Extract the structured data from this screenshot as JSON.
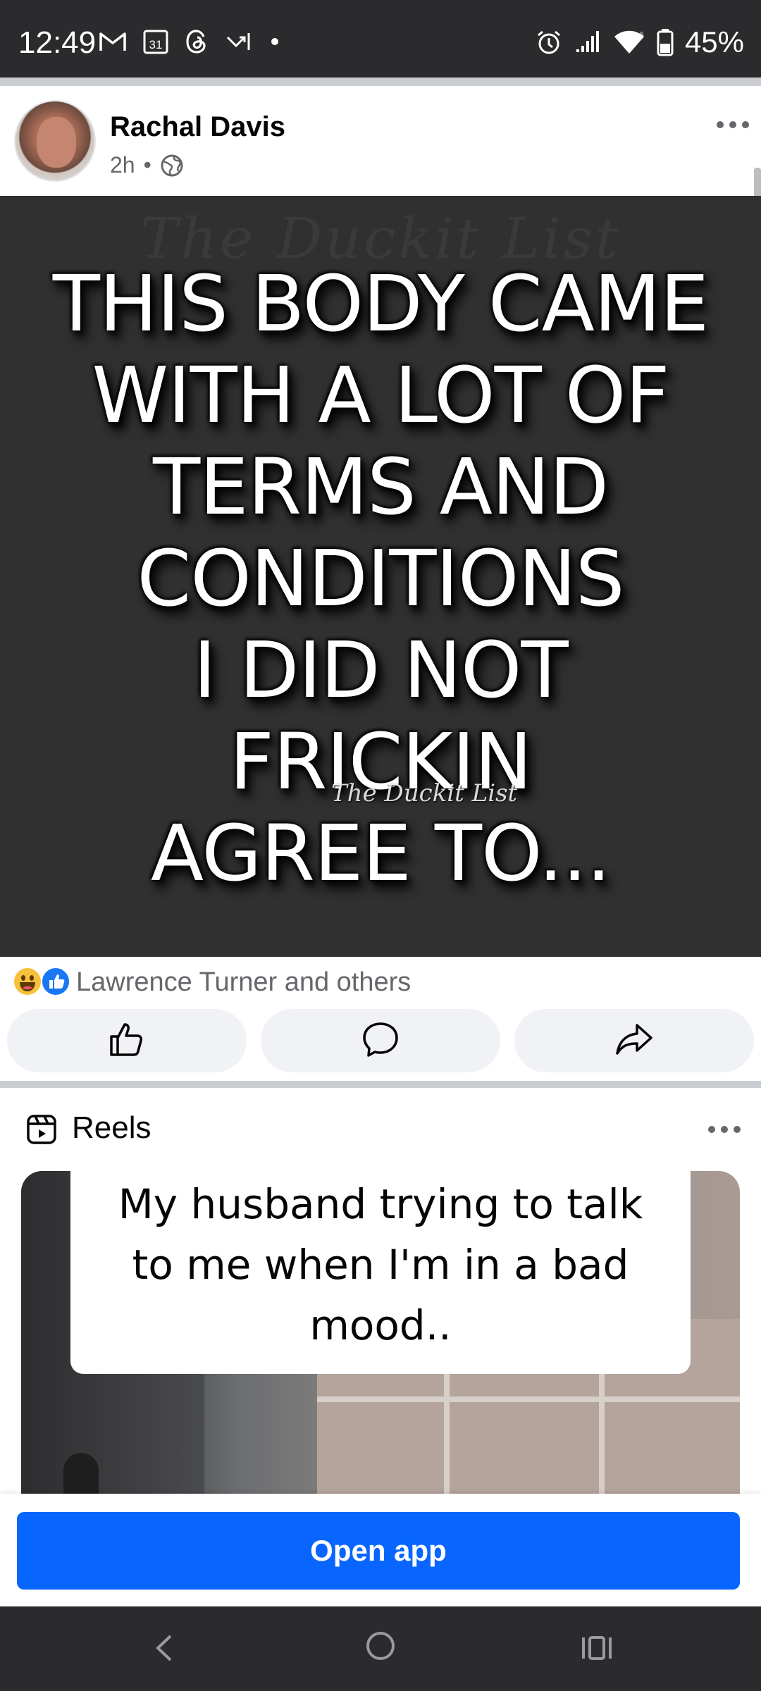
{
  "status_bar": {
    "time": "12:49",
    "battery_percent": "45%",
    "left_icons": [
      "gmail-icon",
      "calendar-icon",
      "threads-icon",
      "missed-call-icon",
      "dot-icon"
    ],
    "right_icons": [
      "alarm-icon",
      "signal-icon",
      "wifi-icon",
      "battery-icon"
    ],
    "calendar_date": "31"
  },
  "post": {
    "author": "Rachal Davis",
    "time_ago": "2h",
    "separator": "•",
    "privacy": "globe-icon",
    "image": {
      "watermark": "The Duckit List",
      "lines": [
        "THIS BODY CAME",
        "WITH A LOT OF",
        "TERMS AND",
        "CONDITIONS",
        "I DID NOT",
        "FRICKIN",
        "AGREE TO..."
      ]
    },
    "reactions_text": "Lawrence Turner and others",
    "reaction_icons": [
      "haha-reaction-icon",
      "like-reaction-icon"
    ],
    "actions": [
      "like",
      "comment",
      "share"
    ]
  },
  "reels": {
    "title": "Reels",
    "caption_lines": [
      "My husband trying to talk",
      "to me when I'm in a bad",
      "mood.."
    ]
  },
  "open_app": {
    "label": "Open app",
    "color": "#0866ff"
  },
  "nav": [
    "back",
    "home",
    "recents"
  ]
}
